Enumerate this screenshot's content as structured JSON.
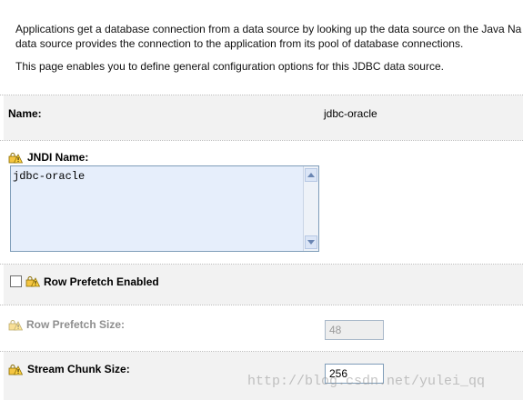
{
  "intro": {
    "line1": "Applications get a database connection from a data source by looking up the data source on the Java Na",
    "line2": "data source provides the connection to the application from its pool of database connections.",
    "line3": "This page enables you to define general configuration options for this JDBC data source."
  },
  "name_row": {
    "label": "Name:",
    "value": "jdbc-oracle"
  },
  "jndi_row": {
    "label": "JNDI Name:",
    "value": "jdbc-oracle"
  },
  "prefetch_enabled_row": {
    "label": "Row Prefetch Enabled",
    "checked": false
  },
  "prefetch_size_row": {
    "label": "Row Prefetch Size:",
    "value": "48",
    "disabled": true
  },
  "stream_chunk_row": {
    "label": "Stream Chunk Size:",
    "value": "256"
  },
  "watermark": "http://blog.csdn.net/yulei_qq",
  "icons": {
    "info_icon": "warning-lock-info-icon",
    "checkbox": "checkbox-icon"
  },
  "colors": {
    "band": "#f2f2f2",
    "textarea_bg": "#e6eefb",
    "field_border": "#7f9db9",
    "disabled_text": "#8e8e8e"
  }
}
